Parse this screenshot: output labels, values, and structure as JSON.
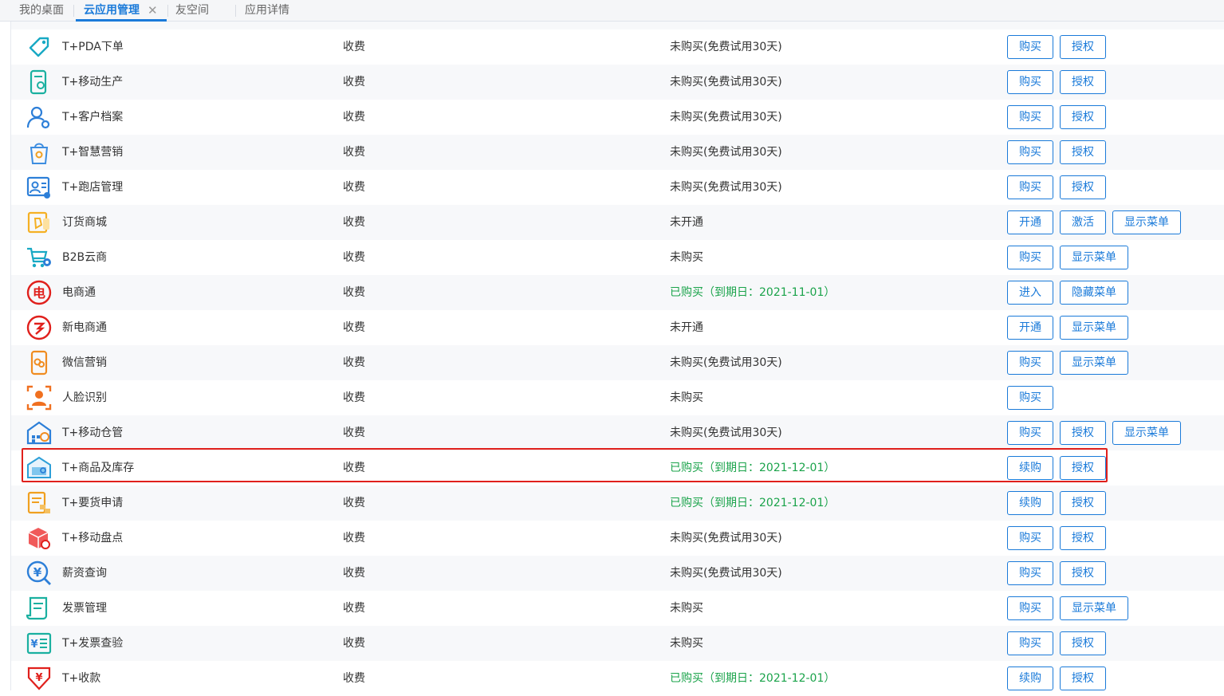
{
  "tabs": [
    {
      "label": "我的桌面",
      "active": false
    },
    {
      "label": "云应用管理",
      "active": true
    },
    {
      "label": "友空间",
      "active": false
    },
    {
      "label": "应用详情",
      "active": false
    }
  ],
  "tab_close_symbol": "✕",
  "accent_color": "#1a7ad9",
  "ok_color": "#1aa34a",
  "highlight_color": "#e0201c",
  "rows": [
    {
      "name": "T+PDA下单",
      "fee": "收费",
      "status": "未购买(免费试用30天)",
      "status_type": "normal",
      "icon": "tag-icon",
      "buttons": [
        "购买",
        "授权"
      ]
    },
    {
      "name": "T+移动生产",
      "fee": "收费",
      "status": "未购买(免费试用30天)",
      "status_type": "normal",
      "icon": "mobile-production-icon",
      "buttons": [
        "购买",
        "授权"
      ]
    },
    {
      "name": "T+客户档案",
      "fee": "收费",
      "status": "未购买(免费试用30天)",
      "status_type": "normal",
      "icon": "customer-profile-icon",
      "buttons": [
        "购买",
        "授权"
      ]
    },
    {
      "name": "T+智慧营销",
      "fee": "收费",
      "status": "未购买(免费试用30天)",
      "status_type": "normal",
      "icon": "smart-marketing-icon",
      "buttons": [
        "购买",
        "授权"
      ]
    },
    {
      "name": "T+跑店管理",
      "fee": "收费",
      "status": "未购买(免费试用30天)",
      "status_type": "normal",
      "icon": "store-visit-icon",
      "buttons": [
        "购买",
        "授权"
      ]
    },
    {
      "name": "订货商城",
      "fee": "收费",
      "status": "未开通",
      "status_type": "normal",
      "icon": "order-mall-icon",
      "buttons": [
        "开通",
        "激活",
        "显示菜单"
      ]
    },
    {
      "name": "B2B云商",
      "fee": "收费",
      "status": "未购买",
      "status_type": "normal",
      "icon": "cart-gear-icon",
      "buttons": [
        "购买",
        "显示菜单"
      ]
    },
    {
      "name": "电商通",
      "fee": "收费",
      "status": "已购买（到期日：2021-11-01）",
      "status_type": "ok",
      "icon": "ecommerce-icon",
      "buttons": [
        "进入",
        "隐藏菜单"
      ]
    },
    {
      "name": "新电商通",
      "fee": "收费",
      "status": "未开通",
      "status_type": "normal",
      "icon": "new-ecommerce-icon",
      "buttons": [
        "开通",
        "显示菜单"
      ]
    },
    {
      "name": "微信营销",
      "fee": "收费",
      "status": "未购买(免费试用30天)",
      "status_type": "normal",
      "icon": "wechat-marketing-icon",
      "buttons": [
        "购买",
        "显示菜单"
      ]
    },
    {
      "name": "人脸识别",
      "fee": "收费",
      "status": "未购买",
      "status_type": "normal",
      "icon": "face-recognition-icon",
      "buttons": [
        "购买"
      ]
    },
    {
      "name": "T+移动仓管",
      "fee": "收费",
      "status": "未购买(免费试用30天)",
      "status_type": "normal",
      "icon": "mobile-warehouse-icon",
      "buttons": [
        "购买",
        "授权",
        "显示菜单"
      ]
    },
    {
      "name": "T+商品及库存",
      "fee": "收费",
      "status": "已购买（到期日：2021-12-01）",
      "status_type": "ok",
      "icon": "goods-inventory-icon",
      "buttons": [
        "续购",
        "授权"
      ],
      "highlighted": true
    },
    {
      "name": "T+要货申请",
      "fee": "收费",
      "status": "已购买（到期日：2021-12-01）",
      "status_type": "ok",
      "icon": "requisition-icon",
      "buttons": [
        "续购",
        "授权"
      ]
    },
    {
      "name": "T+移动盘点",
      "fee": "收费",
      "status": "未购买(免费试用30天)",
      "status_type": "normal",
      "icon": "mobile-stocktake-icon",
      "buttons": [
        "购买",
        "授权"
      ]
    },
    {
      "name": "薪资查询",
      "fee": "收费",
      "status": "未购买(免费试用30天)",
      "status_type": "normal",
      "icon": "salary-query-icon",
      "buttons": [
        "购买",
        "授权"
      ]
    },
    {
      "name": "发票管理",
      "fee": "收费",
      "status": "未购买",
      "status_type": "normal",
      "icon": "invoice-management-icon",
      "buttons": [
        "购买",
        "显示菜单"
      ]
    },
    {
      "name": "T+发票查验",
      "fee": "收费",
      "status": "未购买",
      "status_type": "normal",
      "icon": "invoice-check-icon",
      "buttons": [
        "购买",
        "授权"
      ]
    },
    {
      "name": "T+收款",
      "fee": "收费",
      "status": "已购买（到期日：2021-12-01）",
      "status_type": "ok",
      "icon": "payment-collection-icon",
      "buttons": [
        "续购",
        "授权"
      ]
    }
  ]
}
